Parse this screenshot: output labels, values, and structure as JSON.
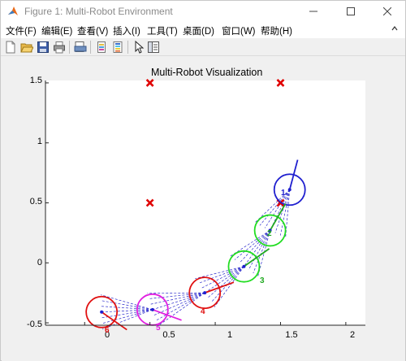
{
  "window": {
    "title": "Figure 1: Multi-Robot Environment",
    "controls": [
      "minimize-icon",
      "maximize-icon",
      "close-icon"
    ]
  },
  "menu": [
    {
      "label": "文件(F)"
    },
    {
      "label": "编辑(E)"
    },
    {
      "label": "查看(V)"
    },
    {
      "label": "插入(I)"
    },
    {
      "label": "工具(T)"
    },
    {
      "label": "桌面(D)"
    },
    {
      "label": "窗口(W)"
    },
    {
      "label": "帮助(H)"
    }
  ],
  "toolbar": [
    "new-figure-icon",
    "open-file-icon",
    "save-icon",
    "print-icon",
    "print-preview-icon",
    "link-plot-icon",
    "insert-colorbar-icon",
    "edit-plot-icon",
    "property-editor-icon"
  ],
  "chart_data": {
    "type": "scatter",
    "title": "Multi-Robot Visualization",
    "xlim": [
      -0.3,
      2.15
    ],
    "ylim": [
      -0.52,
      1.52
    ],
    "xticks": [
      "0",
      "0.5",
      "1",
      "1.5",
      "2"
    ],
    "yticks": [
      "1.5",
      "1",
      "0.5",
      "0",
      "-0.5"
    ],
    "xtick_values": [
      0,
      0.5,
      1,
      1.5,
      2
    ],
    "ytick_values": [
      1.5,
      1,
      0.5,
      0,
      -0.5
    ],
    "targets": [
      {
        "x": 0.5,
        "y": 1.5
      },
      {
        "x": 1.5,
        "y": 1.5
      },
      {
        "x": 0.5,
        "y": 0.5
      },
      {
        "x": 1.5,
        "y": 0.5
      }
    ],
    "target_color": "#e00000",
    "robots": [
      {
        "id": "1",
        "x": 1.57,
        "y": 0.61,
        "heading_deg": 75,
        "color": "#1f1fcf",
        "label_color": "#1f1fcf"
      },
      {
        "id": "2",
        "x": 1.42,
        "y": 0.27,
        "heading_deg": 60,
        "color": "#22dd22",
        "label_color": "#22aa22"
      },
      {
        "id": "3",
        "x": 1.22,
        "y": -0.03,
        "heading_deg": 35,
        "color": "#22dd22",
        "label_color": "#22aa22"
      },
      {
        "id": "4",
        "x": 0.92,
        "y": -0.25,
        "heading_deg": 20,
        "color": "#e01010",
        "label_color": "#e01010"
      },
      {
        "id": "5",
        "x": 0.52,
        "y": -0.39,
        "heading_deg": -20,
        "color": "#e020e0",
        "label_color": "#e020e0"
      },
      {
        "id": "6",
        "x": 0.13,
        "y": -0.41,
        "heading_deg": -35,
        "color": "#e01010",
        "label_color": "#e01010"
      }
    ],
    "labels": [
      "1",
      "2",
      "3",
      "4",
      "5",
      "6"
    ],
    "link_color": "#2b2bcc",
    "grid": false
  }
}
